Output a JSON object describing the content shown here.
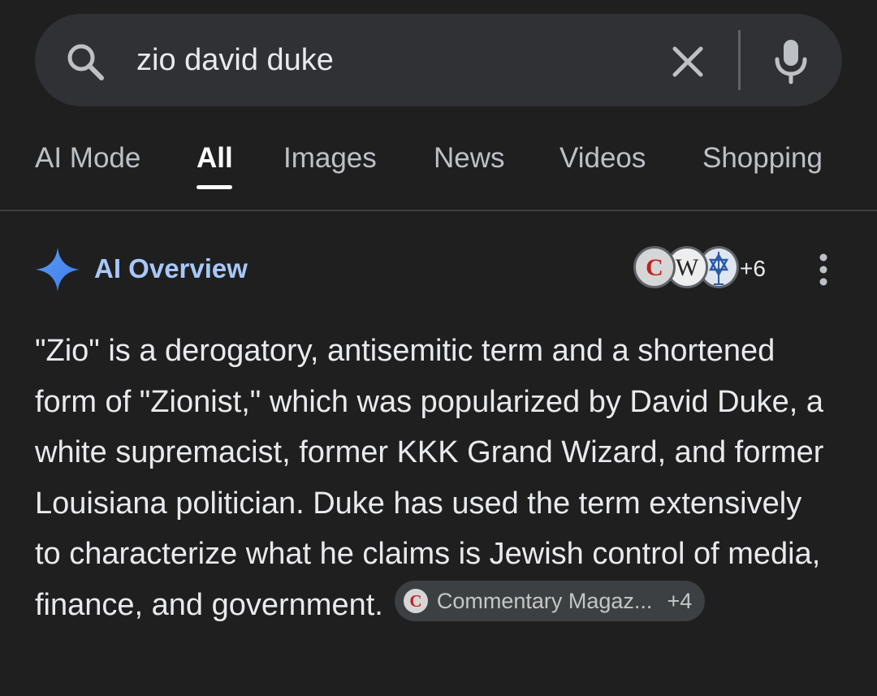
{
  "search": {
    "query": "zio david duke",
    "search_icon": "search-icon",
    "clear_icon": "close-icon",
    "mic_icon": "microphone-icon"
  },
  "tabs": [
    {
      "label": "AI Mode",
      "active": false
    },
    {
      "label": "All",
      "active": true
    },
    {
      "label": "Images",
      "active": false
    },
    {
      "label": "News",
      "active": false
    },
    {
      "label": "Videos",
      "active": false
    },
    {
      "label": "Shopping",
      "active": false
    }
  ],
  "ai_overview": {
    "title": "AI Overview",
    "icon": "sparkle-icon",
    "source_icons": [
      "C",
      "W",
      "star-of-david-tower-icon"
    ],
    "source_more_count": "+6",
    "menu_icon": "more-vert-icon",
    "text": "\"Zio\" is a derogatory, antisemitic term and a shortened form of \"Zionist,\" which was popularized by David Duke, a white supremacist, former KKK Grand Wizard, and former Louisiana politician. Duke has used the term extensively to characterize what he claims is Jewish control of media, finance, and government.",
    "citation": {
      "favicon": "C",
      "label": "Commentary Magaz...",
      "count": "+4"
    }
  },
  "colors": {
    "background": "#1f1f1f",
    "search_bar": "#303134",
    "accent_blue": "#a8c7fa",
    "text": "#e8eaed",
    "muted_text": "#bdc1c6",
    "chip": "#3c4043"
  }
}
